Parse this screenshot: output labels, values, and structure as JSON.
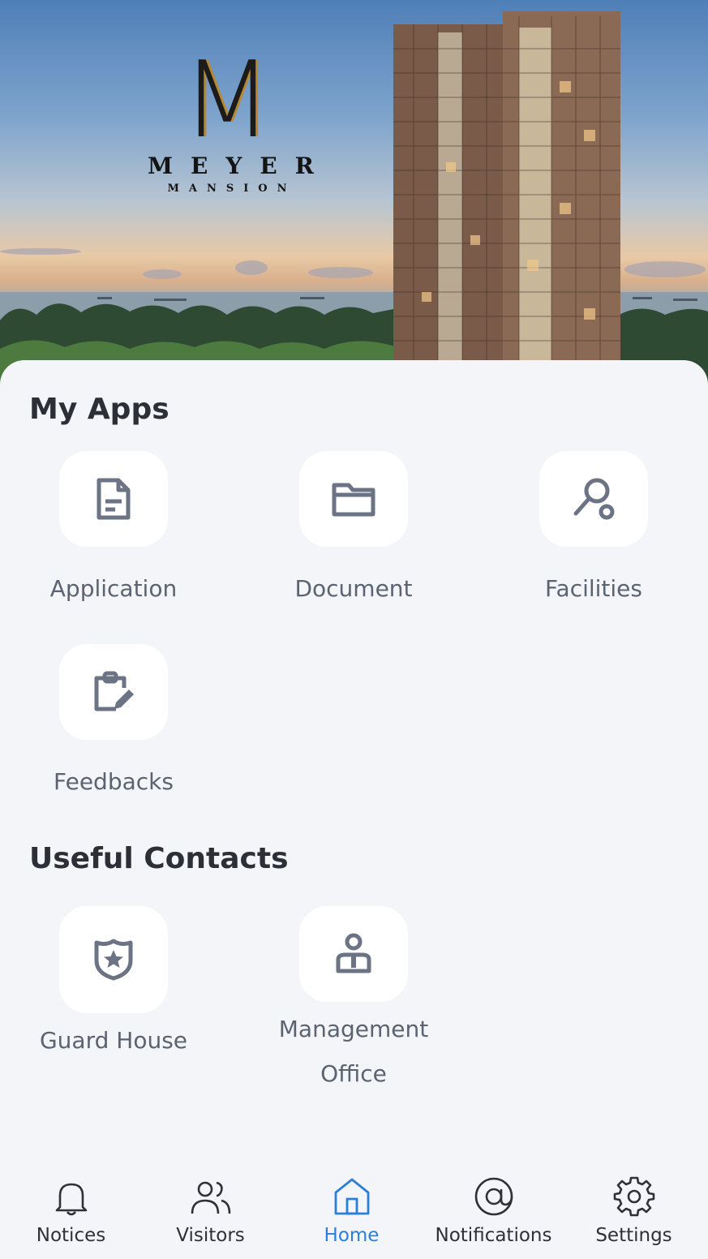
{
  "hero": {
    "logo_letter": "M",
    "logo_name": "MEYER",
    "logo_subtitle": "MANSION"
  },
  "my_apps": {
    "title": "My Apps",
    "items": [
      {
        "label": "Application",
        "icon": "document-icon"
      },
      {
        "label": "Document",
        "icon": "folder-icon"
      },
      {
        "label": "Facilities",
        "icon": "racket-icon"
      },
      {
        "label": "Feedbacks",
        "icon": "clipboard-edit-icon"
      }
    ]
  },
  "useful_contacts": {
    "title": "Useful Contacts",
    "items": [
      {
        "label": "Guard House",
        "icon": "police-badge-icon"
      },
      {
        "label": "Management Office",
        "icon": "officer-icon"
      }
    ]
  },
  "bottom_nav": {
    "items": [
      {
        "label": "Notices",
        "icon": "bell-icon"
      },
      {
        "label": "Visitors",
        "icon": "users-icon"
      },
      {
        "label": "Home",
        "icon": "home-icon",
        "active": true
      },
      {
        "label": "Notifications",
        "icon": "at-icon"
      },
      {
        "label": "Settings",
        "icon": "gear-icon"
      }
    ]
  },
  "colors": {
    "accent": "#2b7fd8",
    "icon": "#6b7384",
    "text": "#2c2f36"
  }
}
